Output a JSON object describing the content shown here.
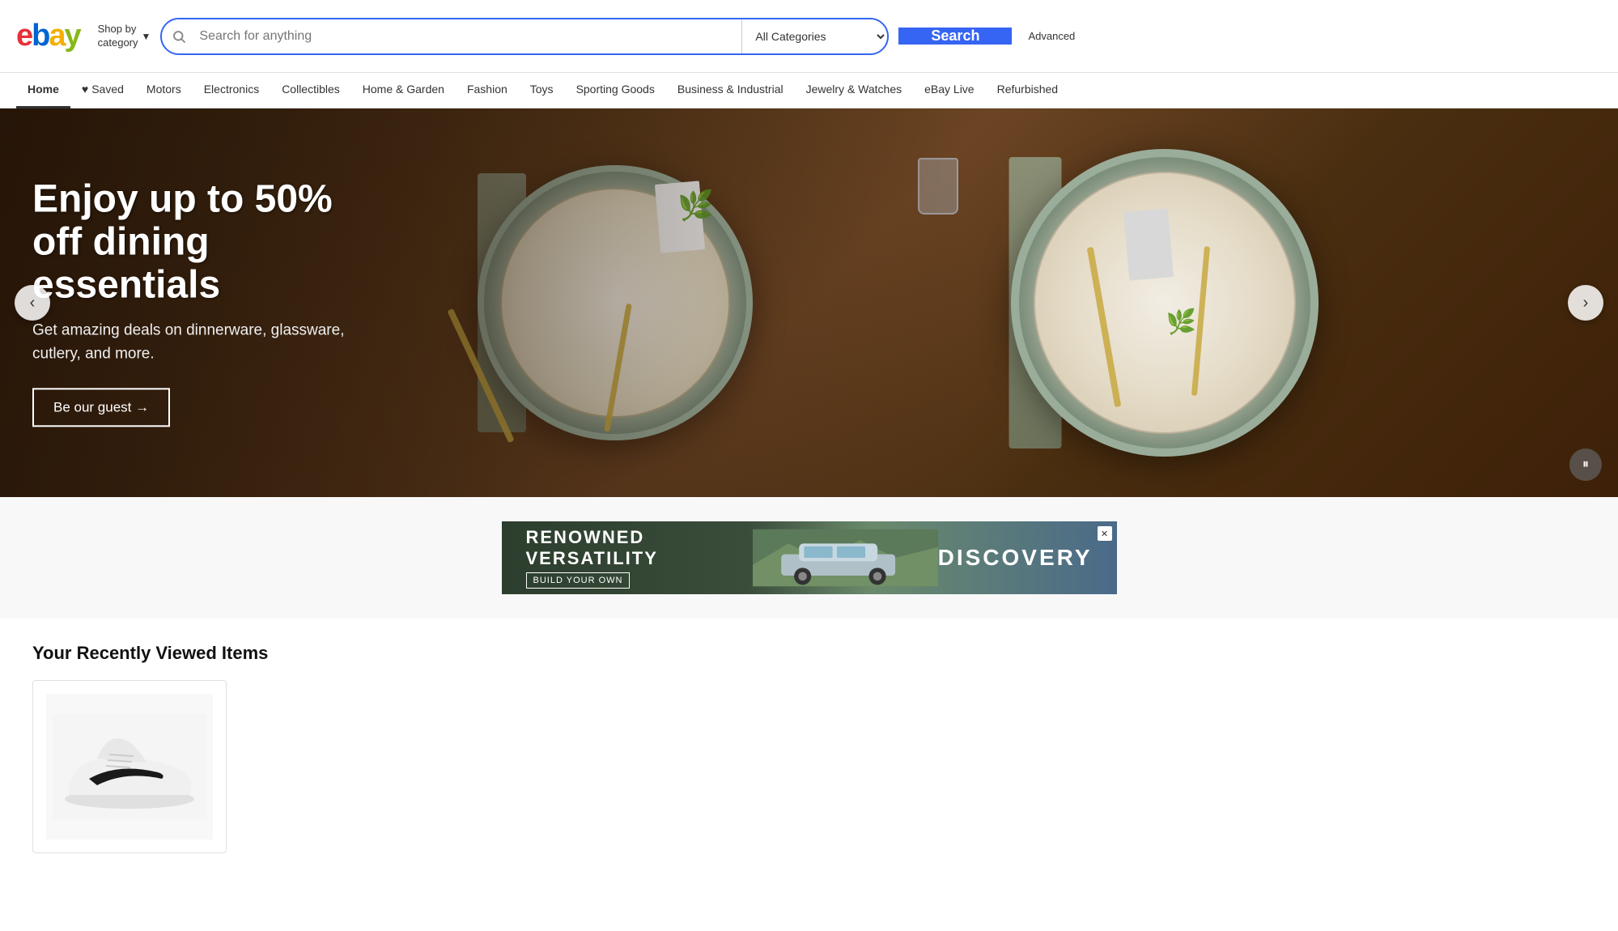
{
  "header": {
    "logo": {
      "e": "e",
      "b": "b",
      "a": "a",
      "y": "y"
    },
    "shop_by_category": "Shop by\ncategory",
    "search_placeholder": "Search for anything",
    "category_select": {
      "selected": "All Categories",
      "options": [
        "All Categories",
        "Motors",
        "Electronics",
        "Collectibles",
        "Home & Garden",
        "Fashion",
        "Toys",
        "Sporting Goods",
        "Business & Industrial",
        "Jewelry & Watches",
        "eBay Live",
        "Refurbished"
      ]
    },
    "search_button": "Search",
    "advanced_link": "Advanced"
  },
  "nav": {
    "items": [
      {
        "label": "Home",
        "active": true
      },
      {
        "label": "Saved",
        "has_heart": true
      },
      {
        "label": "Motors"
      },
      {
        "label": "Electronics"
      },
      {
        "label": "Collectibles"
      },
      {
        "label": "Home & Garden"
      },
      {
        "label": "Fashion"
      },
      {
        "label": "Toys"
      },
      {
        "label": "Sporting Goods"
      },
      {
        "label": "Business & Industrial"
      },
      {
        "label": "Jewelry & Watches"
      },
      {
        "label": "eBay Live"
      },
      {
        "label": "Refurbished"
      }
    ]
  },
  "hero": {
    "title": "Enjoy up to 50% off dining essentials",
    "subtitle": "Get amazing deals on dinnerware, glassware, cutlery, and more.",
    "cta_label": "Be our guest →",
    "prev_label": "‹",
    "next_label": "›",
    "pause_label": "⏸"
  },
  "ad": {
    "title": "RENOWNED VERSATILITY",
    "subtitle": "BUILD YOUR OWN",
    "brand": "DISCOVERY",
    "close": "✕"
  },
  "recently_viewed": {
    "section_title": "Your Recently Viewed Items"
  }
}
